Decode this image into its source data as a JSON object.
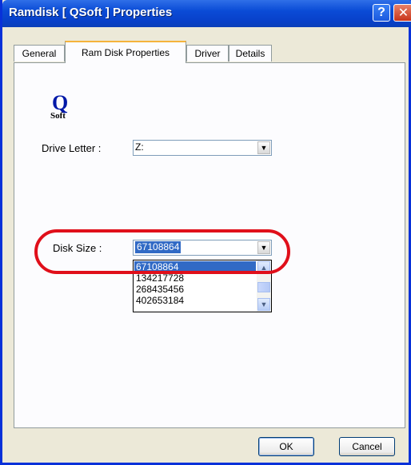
{
  "window": {
    "title": "Ramdisk [ QSoft ] Properties"
  },
  "titlebar": {
    "help_glyph": "?",
    "close_glyph": "✕"
  },
  "tabs": [
    {
      "label": "General",
      "active": false
    },
    {
      "label": "Ram Disk Properties",
      "active": true
    },
    {
      "label": "Driver",
      "active": false
    },
    {
      "label": "Details",
      "active": false
    }
  ],
  "logo": {
    "q": "Q",
    "sub": "Soft"
  },
  "drive_letter": {
    "label": "Drive Letter :",
    "value": "Z:"
  },
  "disk_size": {
    "label": "Disk Size :",
    "value": "67108864",
    "options": [
      "67108864",
      "134217728",
      "268435456",
      "402653184"
    ],
    "selected_index": 0
  },
  "buttons": {
    "ok": "OK",
    "cancel": "Cancel"
  },
  "colors": {
    "selection": "#316ac5",
    "highlight_ring": "#e00f1a",
    "title_bar": "#0a4bd6"
  }
}
